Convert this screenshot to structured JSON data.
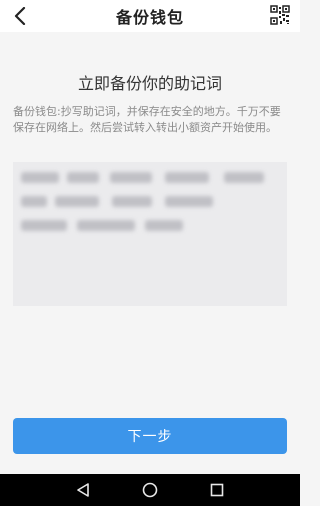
{
  "header": {
    "title": "备份钱包",
    "back_icon": "back-arrow-icon",
    "qr_icon": "qr-code-icon"
  },
  "main": {
    "headline": "立即备份你的助记词",
    "instructions": "备份钱包:抄写助记词，并保存在安全的地方。千万不要保存在网络上。然后尝试转入转出小额资产开始使用。",
    "mnemonic_obscured": true
  },
  "actions": {
    "next_label": "下一步",
    "accent_color": "#3c95ea"
  },
  "system_nav": {
    "back_icon": "triangle-back-icon",
    "home_icon": "circle-home-icon",
    "recents_icon": "square-recents-icon"
  }
}
